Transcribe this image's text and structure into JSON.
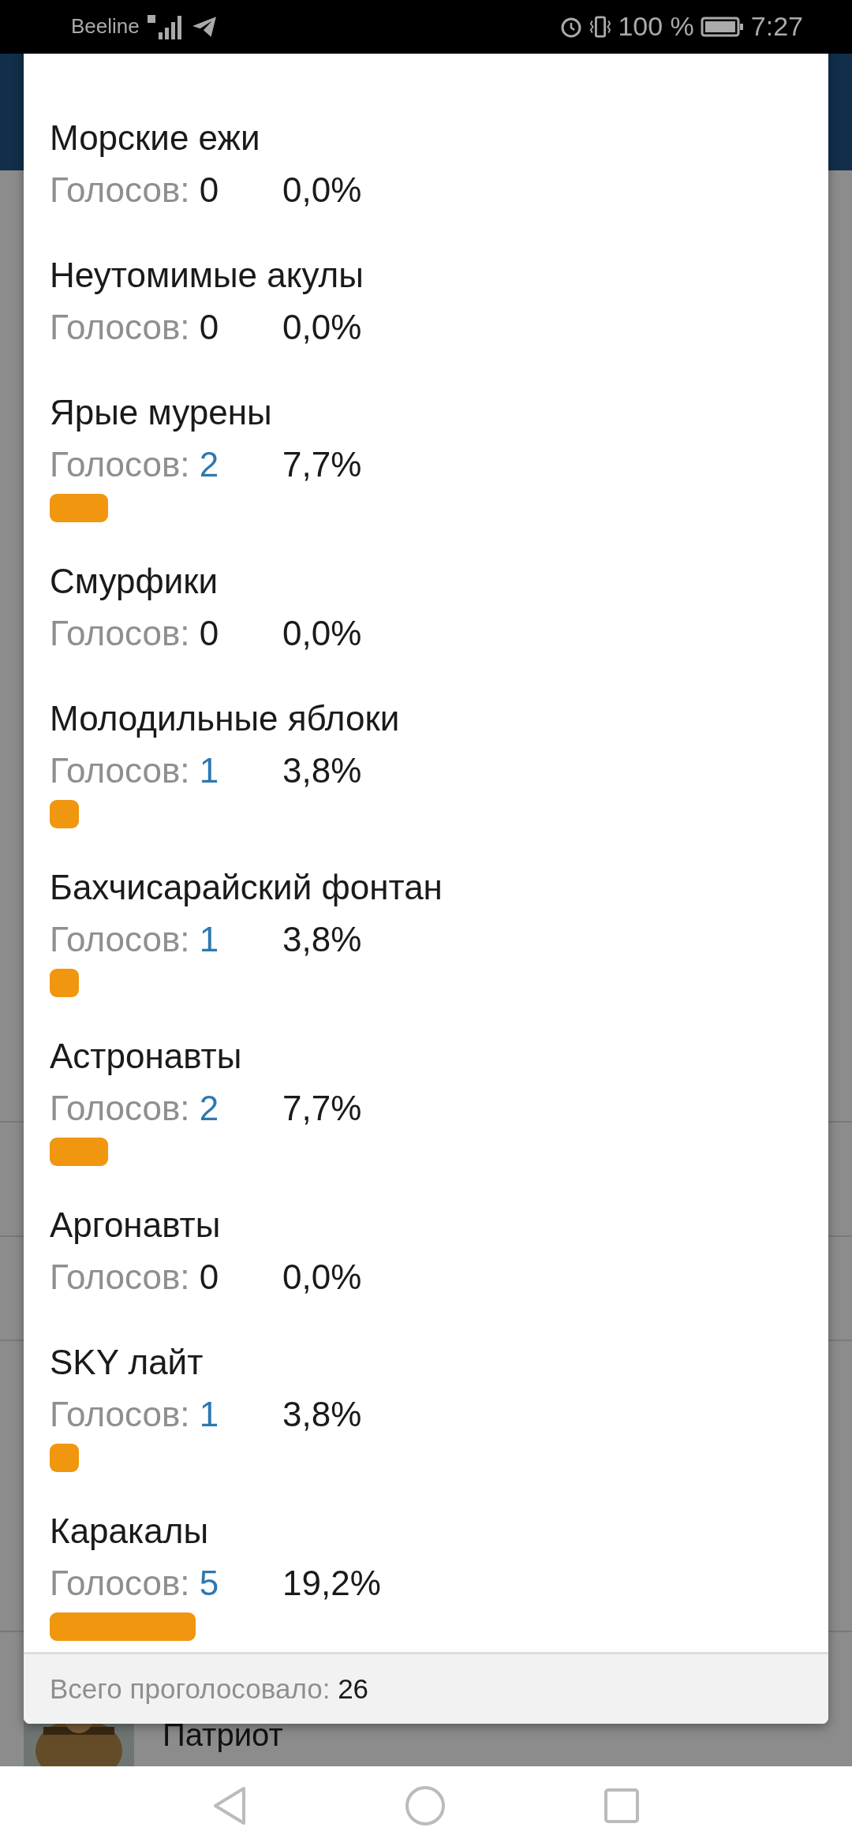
{
  "status_bar": {
    "carrier": "Beeline",
    "battery": "100 %",
    "time": "7:27"
  },
  "background": {
    "row_title": "Патриот"
  },
  "poll": {
    "options": [
      {
        "name": "Морские ежи",
        "vote_label": "Голосов:",
        "votes": "0",
        "percent": "0,0%"
      },
      {
        "name": "Неутомимые акулы",
        "vote_label": "Голосов:",
        "votes": "0",
        "percent": "0,0%"
      },
      {
        "name": "Ярые мурены",
        "vote_label": "Голосов:",
        "votes": "2",
        "percent": "7,7%"
      },
      {
        "name": "Смурфики",
        "vote_label": "Голосов:",
        "votes": "0",
        "percent": "0,0%"
      },
      {
        "name": "Молодильные яблоки",
        "vote_label": "Голосов:",
        "votes": "1",
        "percent": "3,8%"
      },
      {
        "name": "Бахчисарайский фонтан",
        "vote_label": "Голосов:",
        "votes": "1",
        "percent": "3,8%"
      },
      {
        "name": "Астронавты",
        "vote_label": "Голосов:",
        "votes": "2",
        "percent": "7,7%"
      },
      {
        "name": "Аргонавты",
        "vote_label": "Голосов:",
        "votes": "0",
        "percent": "0,0%"
      },
      {
        "name": "SKY лайт",
        "vote_label": "Голосов:",
        "votes": "1",
        "percent": "3,8%"
      },
      {
        "name": "Каракалы",
        "vote_label": "Голосов:",
        "votes": "5",
        "percent": "19,2%"
      }
    ],
    "total_label": "Всего проголосовало:",
    "total": "26"
  }
}
